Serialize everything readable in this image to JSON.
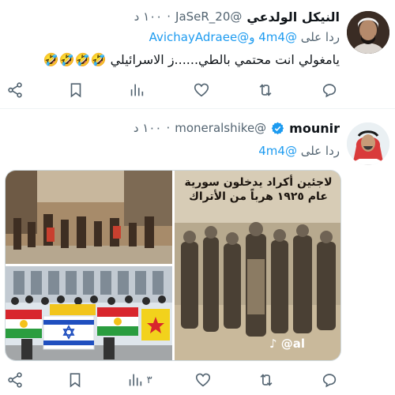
{
  "tweet1": {
    "display_name": "النيكل الولدعي",
    "handle": "@JaSeR_20",
    "dot": "·",
    "time": "١٠٠ د",
    "reply_prefix": "ردا على",
    "reply_mention_1": "@4m4",
    "reply_joiner": "و",
    "reply_mention_2": "@AvichayAdraee",
    "text": "يامغولي انت محتمي بالطي......ز الاسرائيلي",
    "emojis": "🤣🤣🤣🤣",
    "stats": {
      "reply": "",
      "retweet": "",
      "like": "",
      "views": ""
    }
  },
  "tweet2": {
    "display_name": "mounir",
    "handle": "@moneralshike",
    "dot": "·",
    "time": "١٠٠ د",
    "reply_prefix": "ردا على",
    "reply_mention_1": "@4m4",
    "media_overlay_text": "لاجئين أكراد يدخلون سورية عام ١٩٢٥ هرباً من الأتراك",
    "media_watermark": "♪ @al",
    "stats": {
      "reply": "",
      "retweet": "",
      "like": "",
      "views": "٣"
    }
  },
  "colors": {
    "link": "#1d9bf0",
    "muted": "#536471",
    "verified": "#1d9bf0",
    "text": "#0f1419"
  },
  "icons": [
    "share-icon",
    "bookmark-icon",
    "views-icon",
    "like-icon",
    "retweet-icon",
    "reply-icon",
    "verified-icon"
  ]
}
